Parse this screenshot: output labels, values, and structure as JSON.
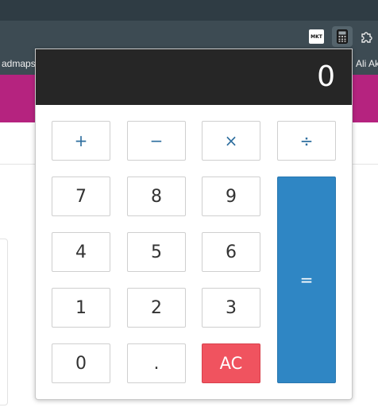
{
  "browser": {
    "bookmarks_left": "admaps",
    "bookmarks_right": "Ali Ak",
    "extensions": [
      {
        "name": "mkt-extension",
        "label": "MKT"
      },
      {
        "name": "calculator-extension"
      },
      {
        "name": "extensions-puzzle"
      }
    ],
    "colors": {
      "tabbar": "#2f3c44",
      "toolbar": "#3d4b53",
      "page_header": "#b5237f"
    }
  },
  "calculator": {
    "display_value": "0",
    "keys": {
      "plus": "+",
      "minus": "−",
      "multiply": "×",
      "divide": "÷",
      "seven": "7",
      "eight": "8",
      "nine": "9",
      "four": "4",
      "five": "5",
      "six": "6",
      "one": "1",
      "two": "2",
      "three": "3",
      "zero": "0",
      "decimal": ".",
      "clear": "AC",
      "equals": "="
    },
    "colors": {
      "display_bg": "#262626",
      "operator_text": "#2f6f9f",
      "clear_bg": "#f0535f",
      "equals_bg": "#2f86c4"
    }
  }
}
